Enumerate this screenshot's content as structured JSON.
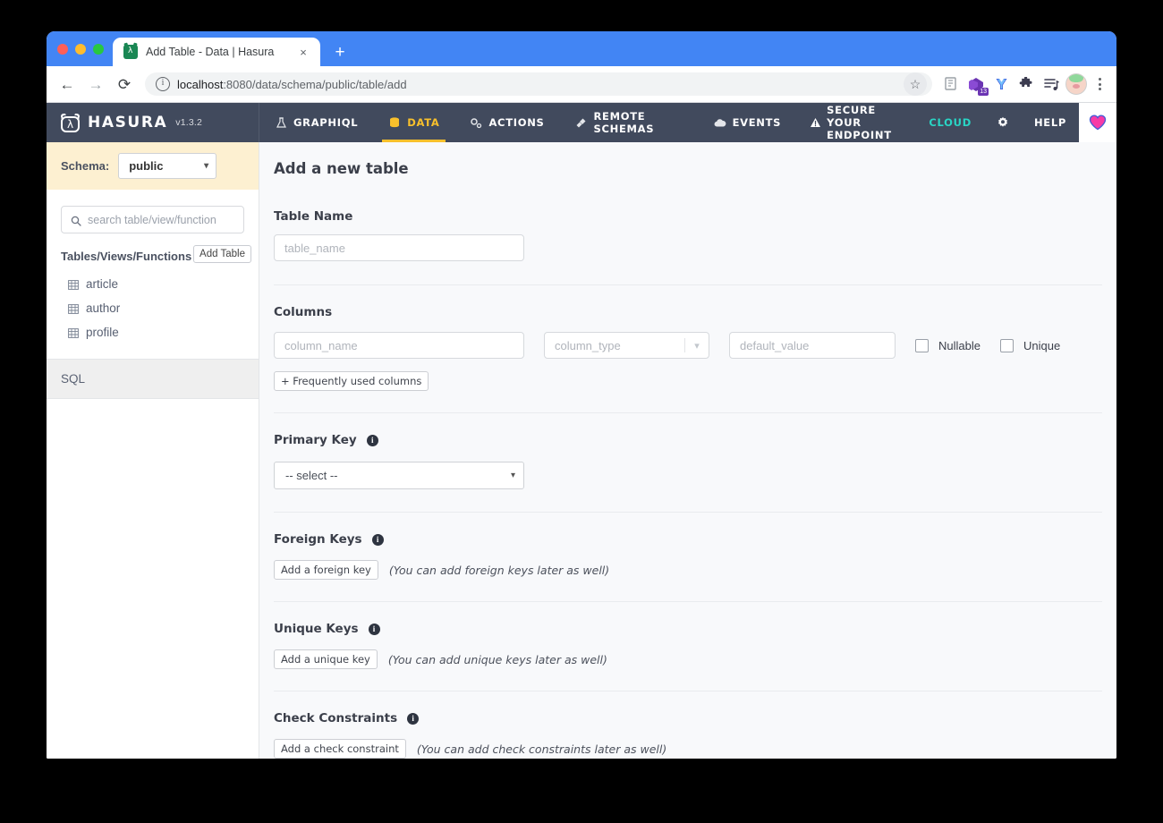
{
  "browser": {
    "tab": {
      "title": "Add Table - Data | Hasura",
      "close_label": "×",
      "favicon_name": "hasura-favicon"
    },
    "newtab_label": "+",
    "back_label": "←",
    "forward_label": "→",
    "reload_label": "⟳",
    "url_host": "localhost",
    "url_rest": ":8080/data/schema/public/table/add",
    "star_label": "☆",
    "extension_badge": "13",
    "menu_label": "⋮"
  },
  "topnav": {
    "brand": "HASURA",
    "version": "v1.3.2",
    "items": [
      {
        "label": "GRAPHIQL",
        "icon": "flask-icon",
        "active": false
      },
      {
        "label": "DATA",
        "icon": "database-icon",
        "active": true
      },
      {
        "label": "ACTIONS",
        "icon": "gears-icon",
        "active": false
      },
      {
        "label": "REMOTE SCHEMAS",
        "icon": "plug-icon",
        "active": false
      },
      {
        "label": "EVENTS",
        "icon": "cloud-icon",
        "active": false
      }
    ],
    "secure_endpoint": "SECURE YOUR ENDPOINT",
    "cloud": "CLOUD",
    "help": "HELP",
    "settings_icon": "gear-icon",
    "heart_icon": "heart-icon",
    "colors": {
      "bg": "#414a5d",
      "active": "#f8c02c",
      "cloud": "#29d5c5"
    }
  },
  "sidebar": {
    "schema_label": "Schema:",
    "schema_value": "public",
    "search_placeholder": "search table/view/function",
    "tvf_heading": "Tables/Views/Functions (3)",
    "add_table_label": "Add Table",
    "tables": [
      {
        "name": "article"
      },
      {
        "name": "author"
      },
      {
        "name": "profile"
      }
    ],
    "sql_label": "SQL"
  },
  "main": {
    "title": "Add a new table",
    "table_name": {
      "label": "Table Name",
      "placeholder": "table_name"
    },
    "columns": {
      "label": "Columns",
      "column_name_placeholder": "column_name",
      "column_type_placeholder": "column_type",
      "default_value_placeholder": "default_value",
      "nullable_label": "Nullable",
      "unique_label": "Unique",
      "frequently_used_label": "+ Frequently used columns"
    },
    "primary_key": {
      "label": "Primary Key",
      "select_value": "-- select --"
    },
    "foreign_keys": {
      "label": "Foreign Keys",
      "button": "Add a foreign key",
      "hint": "(You can add foreign keys later as well)"
    },
    "unique_keys": {
      "label": "Unique Keys",
      "button": "Add a unique key",
      "hint": "(You can add unique keys later as well)"
    },
    "check_constraints": {
      "label": "Check Constraints",
      "button": "Add a check constraint",
      "hint": "(You can add check constraints later as well)"
    }
  }
}
